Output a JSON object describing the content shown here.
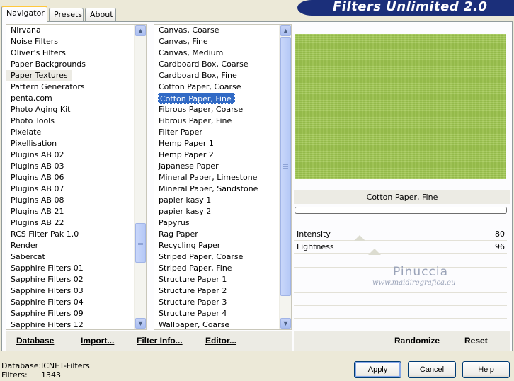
{
  "app_title": "Filters Unlimited 2.0",
  "tabs": [
    {
      "label": "Navigator",
      "active": true
    },
    {
      "label": "Presets",
      "active": false
    },
    {
      "label": "About",
      "active": false
    }
  ],
  "categories": {
    "items": [
      "Nirvana",
      "Noise Filters",
      "Oliver's Filters",
      "Paper Backgrounds",
      "Paper Textures",
      "Pattern Generators",
      "penta.com",
      "Photo Aging Kit",
      "Photo Tools",
      "Pixelate",
      "Pixellisation",
      "Plugins AB 02",
      "Plugins AB 03",
      "Plugins AB 06",
      "Plugins AB 07",
      "Plugins AB 08",
      "Plugins AB 21",
      "Plugins AB 22",
      "RCS Filter Pak 1.0",
      "Render",
      "Sabercat",
      "Sapphire Filters 01",
      "Sapphire Filters 02",
      "Sapphire Filters 03",
      "Sapphire Filters 04",
      "Sapphire Filters 09",
      "Sapphire Filters 12"
    ],
    "selected": "Paper Textures"
  },
  "filters": {
    "items": [
      "Canvas, Coarse",
      "Canvas, Fine",
      "Canvas, Medium",
      "Cardboard Box, Coarse",
      "Cardboard Box, Fine",
      "Cotton Paper, Coarse",
      "Cotton Paper, Fine",
      "Fibrous Paper, Coarse",
      "Fibrous Paper, Fine",
      "Filter Paper",
      "Hemp Paper 1",
      "Hemp Paper 2",
      "Japanese Paper",
      "Mineral Paper, Limestone",
      "Mineral Paper, Sandstone",
      "papier kasy 1",
      "papier kasy 2",
      "Papyrus",
      "Rag Paper",
      "Recycling Paper",
      "Striped Paper, Coarse",
      "Striped Paper, Fine",
      "Structure Paper 1",
      "Structure Paper 2",
      "Structure Paper 3",
      "Structure Paper 4",
      "Wallpaper, Coarse"
    ],
    "selected": "Cotton Paper, Fine"
  },
  "toolbar": {
    "database": "Database",
    "import": "Import...",
    "filter_info": "Filter Info...",
    "editor": "Editor..."
  },
  "preview": {
    "filter_name": "Cotton Paper, Fine",
    "color": "#9fc74f"
  },
  "params": [
    {
      "label": "Intensity",
      "value": "80",
      "level_fraction": 0.31
    },
    {
      "label": "Lightness",
      "value": "96",
      "level_fraction": 0.38
    }
  ],
  "right_toolbar": {
    "randomize": "Randomize",
    "reset": "Reset"
  },
  "watermark": {
    "name": "Pinuccia",
    "site": "www.maidiregrafica.eu"
  },
  "status": {
    "database_label": "Database:",
    "database_value": "ICNET-Filters",
    "filters_label": "Filters:",
    "filters_value": "1343"
  },
  "buttons": {
    "apply": "Apply",
    "cancel": "Cancel",
    "help": "Help"
  }
}
